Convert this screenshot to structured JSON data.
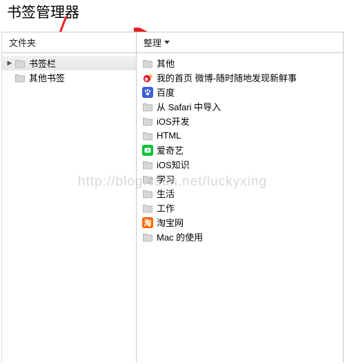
{
  "annotation": {
    "title": "书签管理器"
  },
  "left": {
    "header": "文件夹",
    "items": [
      {
        "label": "书签栏",
        "selected": true,
        "expandable": true
      },
      {
        "label": "其他书签",
        "selected": false,
        "expandable": false
      }
    ]
  },
  "right": {
    "header": "整理",
    "items": [
      {
        "icon": "folder",
        "label": "其他"
      },
      {
        "icon": "weibo",
        "label": "我的首页 微博-随时随地发现新鲜事"
      },
      {
        "icon": "baidu",
        "label": "百度"
      },
      {
        "icon": "folder",
        "label": "从 Safari 中导入"
      },
      {
        "icon": "folder",
        "label": "iOS开发"
      },
      {
        "icon": "folder",
        "label": "HTML"
      },
      {
        "icon": "iqiyi",
        "label": "爱奇艺"
      },
      {
        "icon": "folder",
        "label": "iOS知识"
      },
      {
        "icon": "folder",
        "label": "学习"
      },
      {
        "icon": "folder",
        "label": "生活"
      },
      {
        "icon": "folder",
        "label": "工作"
      },
      {
        "icon": "taobao",
        "label": "淘宝网"
      },
      {
        "icon": "folder",
        "label": "Mac 的使用"
      }
    ]
  },
  "watermark": "http://blog.csdn.net/luckyxing"
}
